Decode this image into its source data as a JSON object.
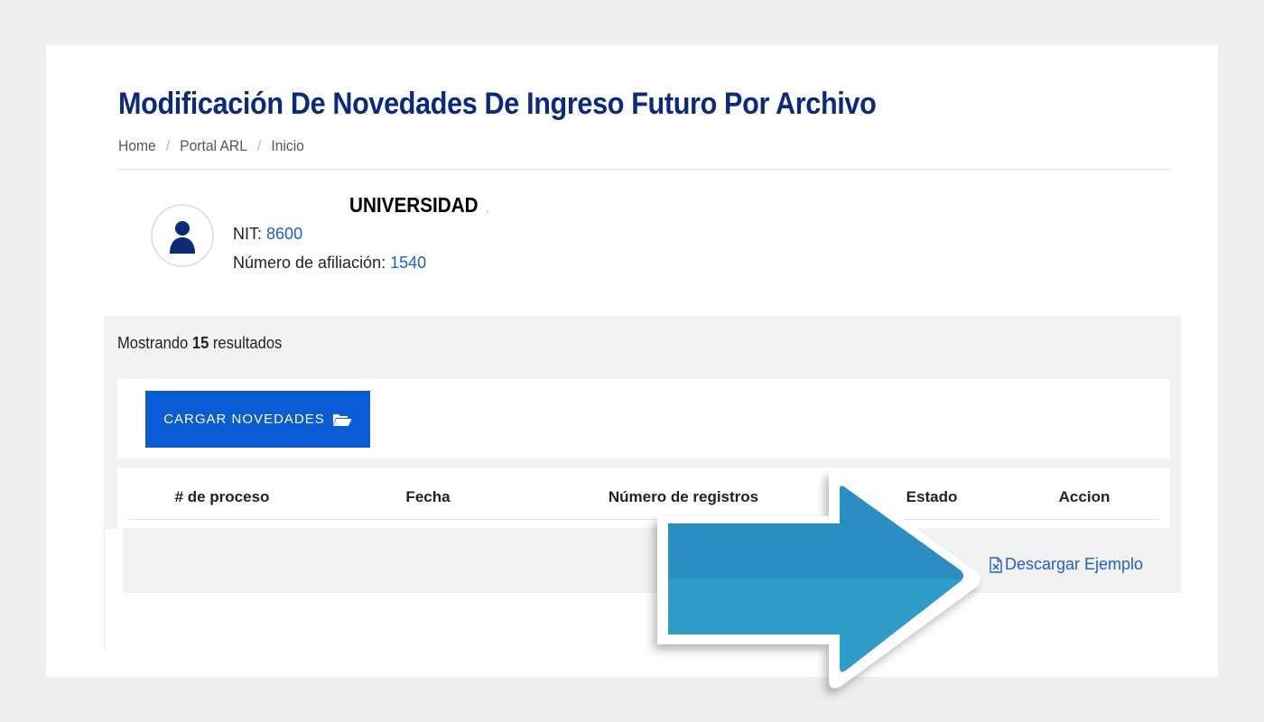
{
  "page": {
    "title": "Modificación De Novedades De Ingreso Futuro Por Archivo",
    "breadcrumb": [
      "Home",
      "Portal ARL",
      "Inicio"
    ]
  },
  "company": {
    "name": "UNIVERSIDAD",
    "nit_label": "NIT:",
    "nit_value": "8600",
    "afiliacion_label": "Número de afiliación:",
    "afiliacion_value": "1540"
  },
  "results": {
    "prefix": "Mostrando",
    "count": "15",
    "suffix": "resultados"
  },
  "toolbar": {
    "upload_label": "CARGAR NOVEDADES"
  },
  "table": {
    "columns": [
      "# de proceso",
      "Fecha",
      "Número de registros",
      "Estado",
      "Accion"
    ]
  },
  "row_action": {
    "download_label": "Descargar Ejemplo"
  },
  "colors": {
    "title": "#0b2a7a",
    "primary_button": "#0a5bd6",
    "link": "#1f5fc8",
    "arrow": "#2b93c6"
  },
  "icons": [
    "user-icon",
    "folder-open-icon",
    "excel-file-icon",
    "arrow-right-icon"
  ]
}
